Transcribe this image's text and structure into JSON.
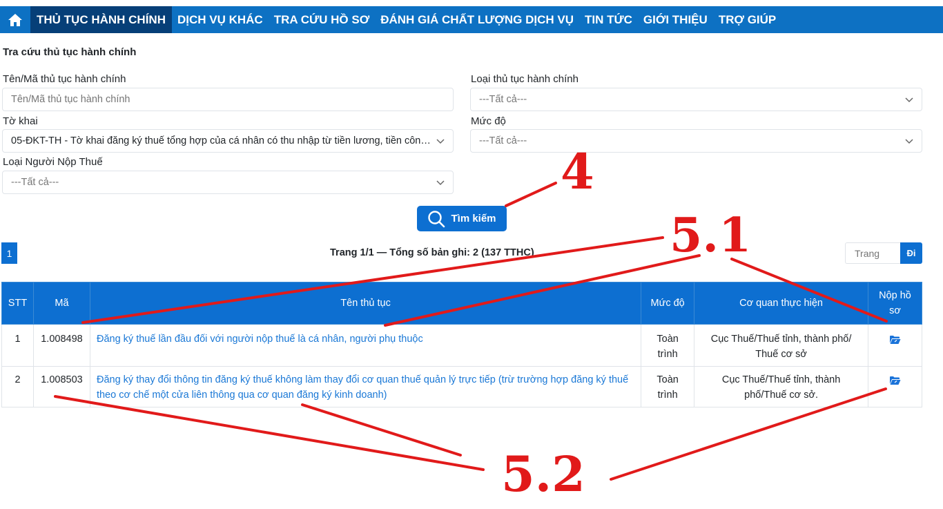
{
  "nav": {
    "items": [
      "THỦ TỤC HÀNH CHÍNH",
      "DỊCH VỤ KHÁC",
      "TRA CỨU HỒ SƠ",
      "ĐÁNH GIÁ CHẤT LƯỢNG DỊCH VỤ",
      "TIN TỨC",
      "GIỚI THIỆU",
      "TRỢ GIÚP"
    ],
    "active_index": 0
  },
  "section_title": "Tra cứu thủ tục hành chính",
  "form": {
    "name_label": "Tên/Mã thủ tục hành chính",
    "name_placeholder": "Tên/Mã thủ tục hành chính",
    "type_label": "Loại thủ tục hành chính",
    "type_value": "---Tất cả---",
    "form_label": "Tờ khai",
    "form_value": "05-ĐKT-TH - Tờ khai đăng ký thuế tổng hợp của cá nhân có thu nhập từ tiền lương, tiền công...",
    "level_label": "Mức độ",
    "level_value": "---Tất cả---",
    "taxpayer_label": "Loại Người Nộp Thuế",
    "taxpayer_value": "---Tất cả---"
  },
  "search_button": "Tìm kiếm",
  "pagination": {
    "current_page": "1",
    "info": "Trang 1/1 — Tổng số bản ghi: 2 (137 TTHC)",
    "page_placeholder": "Trang",
    "go_label": "Đi"
  },
  "table": {
    "headers": [
      "STT",
      "Mã",
      "Tên thủ tục",
      "Mức độ",
      "Cơ quan thực hiện",
      "Nộp hồ sơ"
    ],
    "rows": [
      {
        "stt": "1",
        "code": "1.008498",
        "name": "Đăng ký thuế lần đầu đối với người nộp thuế là cá nhân, người phụ thuộc",
        "level": "Toàn trình",
        "agency": "Cục Thuế/Thuế tỉnh, thành phố/ Thuế cơ sở"
      },
      {
        "stt": "2",
        "code": "1.008503",
        "name": "Đăng ký thay đổi thông tin đăng ký thuế không làm thay đổi cơ quan thuế quản lý trực tiếp (trừ trường hợp đăng ký thuế theo cơ chế một cửa liên thông qua cơ quan đăng ký kinh doanh)",
        "level": "Toàn trình",
        "agency": "Cục Thuế/Thuế tỉnh, thành phố/Thuế cơ sở."
      }
    ]
  },
  "annotations": {
    "label_4": "4",
    "label_5_1": "5.1",
    "label_5_2": "5.2",
    "color": "#e11a1a"
  },
  "colors": {
    "nav_bg": "#0d71c3",
    "nav_active": "#063f78",
    "primary": "#0d6fd1",
    "link": "#1a78d6"
  }
}
